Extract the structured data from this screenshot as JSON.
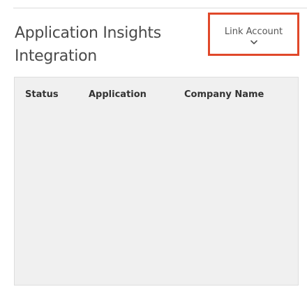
{
  "header": {
    "title": "Application Insights Integration",
    "link_account_label": "Link Account",
    "link_account_icon": "chevron-down-icon",
    "highlight_color": "#e0482a"
  },
  "table": {
    "columns": [
      "Status",
      "Application",
      "Company Name"
    ],
    "rows": []
  }
}
